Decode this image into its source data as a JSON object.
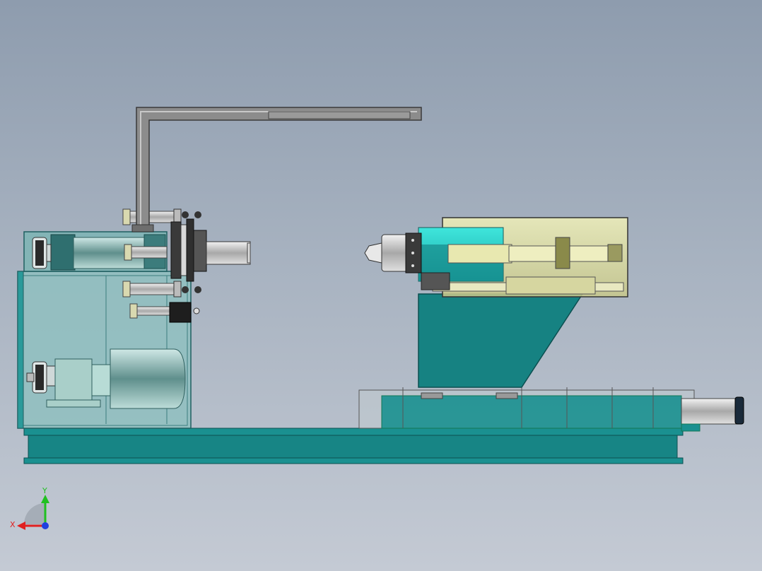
{
  "viewport": {
    "background_top": "#8e9cae",
    "background_bottom": "#c4cad4"
  },
  "colors": {
    "base_teal": "#1a8a8a",
    "base_teal_dark": "#0f6e70",
    "housing_transparent": "#9fd0d0",
    "yellow_housing": "#d9d99a",
    "cyan_highlight": "#30d8d0",
    "steel": "#c8c8c8",
    "dark_part": "#2a2a2a",
    "pipe_gray": "#7a7a7a"
  },
  "triad": {
    "x_label": "X",
    "y_label": "Y",
    "x_color": "#e02020",
    "y_color": "#20c020",
    "z_color": "#2040e0"
  }
}
